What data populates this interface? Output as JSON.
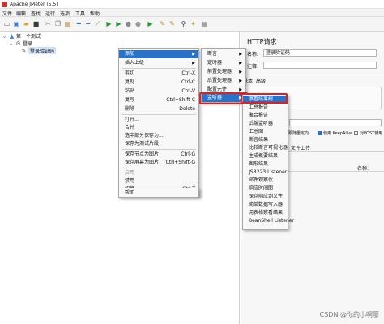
{
  "window": {
    "title": "Apache JMeter (5.5)"
  },
  "menubar": [
    "文件",
    "编辑",
    "查找",
    "运行",
    "选项",
    "工具",
    "帮助"
  ],
  "toolbar_icons": [
    "new-icon",
    "templates-icon",
    "open-icon",
    "save-icon",
    "cut-icon",
    "copy-icon",
    "paste-icon",
    "expand-icon",
    "collapse-icon",
    "toggle-icon",
    "start-icon",
    "start-no-pause-icon",
    "stop-icon",
    "shutdown-icon",
    "remote-start-icon",
    "clear-icon",
    "clear-all-icon",
    "search-icon",
    "reset-search-icon",
    "function-helper-icon"
  ],
  "tree": {
    "plan": "第一个测试",
    "group": "登录",
    "sampler": "登录验证码"
  },
  "context_menu": {
    "items": [
      {
        "label": "添加",
        "accel": "",
        "submenu": true
      },
      {
        "label": "插入上级",
        "accel": "",
        "submenu": true
      },
      {
        "label": "剪切",
        "accel": "Ctrl-X"
      },
      {
        "label": "复制",
        "accel": "Ctrl-C"
      },
      {
        "label": "粘贴",
        "accel": "Ctrl-V"
      },
      {
        "label": "复写",
        "accel": "Ctrl+Shift-C"
      },
      {
        "label": "删除",
        "accel": "Delete"
      },
      {
        "label": "打开...",
        "accel": ""
      },
      {
        "label": "合并",
        "accel": ""
      },
      {
        "label": "选中部分保存为...",
        "accel": ""
      },
      {
        "label": "保存为测试片段",
        "accel": ""
      },
      {
        "label": "保存节点为图片",
        "accel": "Ctrl-G"
      },
      {
        "label": "保存屏幕为图片",
        "accel": "Ctrl+Shift-G"
      },
      {
        "label": "启用",
        "accel": ""
      },
      {
        "label": "禁用",
        "accel": ""
      },
      {
        "label": "切换",
        "accel": "Ctrl-T"
      },
      {
        "label": "帮助",
        "accel": ""
      }
    ]
  },
  "add_submenu": {
    "items": [
      {
        "label": "断言",
        "submenu": true
      },
      {
        "label": "定时器",
        "submenu": true
      },
      {
        "label": "前置处理器",
        "submenu": true
      },
      {
        "label": "后置处理器",
        "submenu": true
      },
      {
        "label": "配置元件",
        "submenu": true
      },
      {
        "label": "监听器",
        "submenu": true
      }
    ]
  },
  "listener_submenu": {
    "items": [
      "察看结果树",
      "汇总报告",
      "聚合报告",
      "后端监听器",
      "汇总图",
      "断言结果",
      "比较断言可视化器",
      "生成概要结果",
      "图形结果",
      "JSR223 Listener",
      "邮件观察仪",
      "响应时间图",
      "保存响应到文件",
      "简单数据写入器",
      "用表格察看结果",
      "BeanShell Listener"
    ]
  },
  "right_panel": {
    "title": "HTTP请求",
    "name_label": "名称:",
    "name_value": "登录验证码",
    "comment_label": "注释:",
    "tabs": [
      "基本",
      "高级"
    ],
    "options": [
      "跟随重定向",
      "使用 KeepAlive",
      "对POST使用"
    ],
    "tab_upload": "文件上传",
    "col_name": "名称:"
  },
  "watermark": "CSDN @你的小啊廖"
}
